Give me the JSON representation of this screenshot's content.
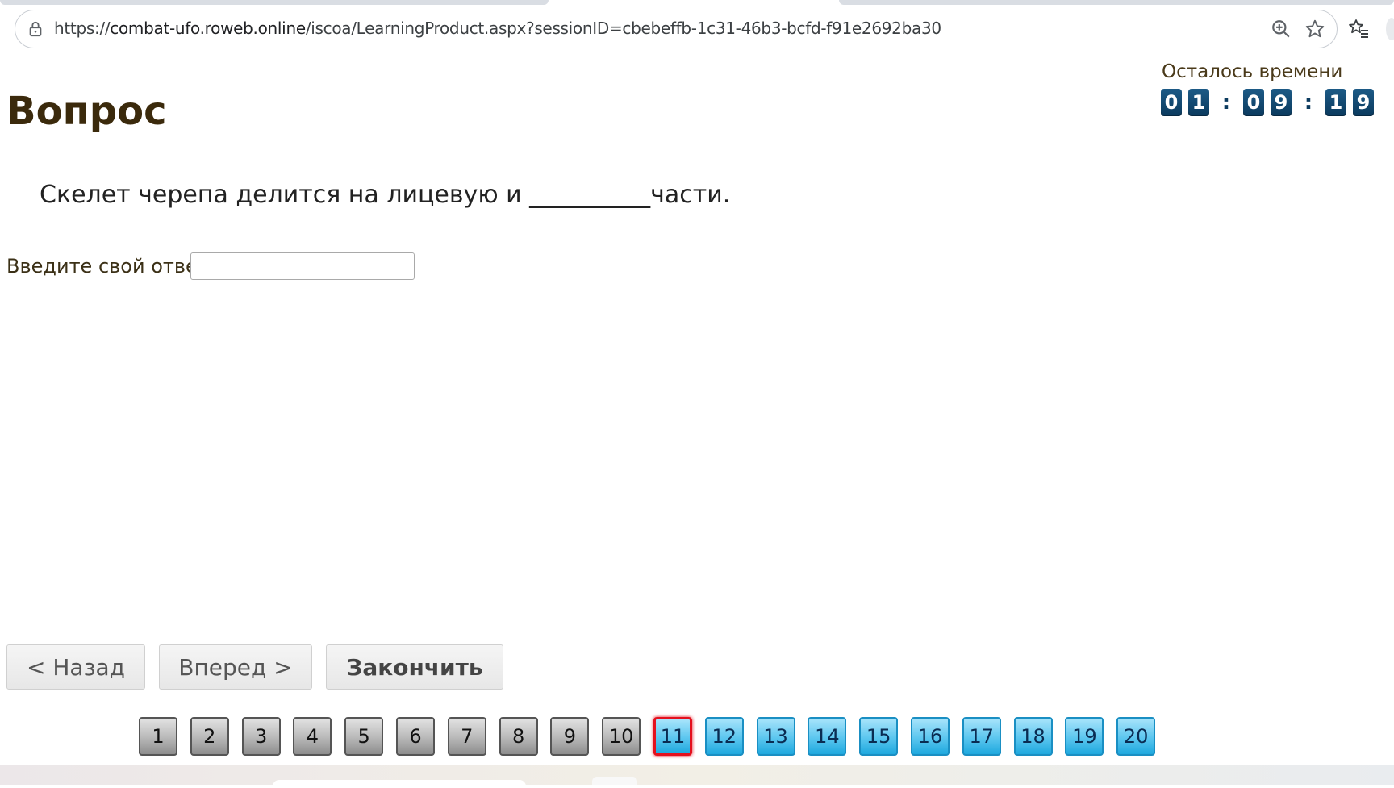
{
  "browser": {
    "url_prefix": "https://",
    "url_domain": "combat-ufo.roweb.online",
    "url_path": "/iscoa/LearningProduct.aspx?sessionID=cbebeffb-1c31-46b3-bcfd-f91e2692ba30"
  },
  "page": {
    "title": "Вопрос",
    "timer_label": "Осталось времени",
    "timer_digits": [
      "0",
      "1",
      "0",
      "9",
      "1",
      "9"
    ],
    "timer_separator": ":",
    "question": "Скелет черепа делится на лицевую и __________части.",
    "answer_label": "Введите свой ответ",
    "answer_value": ""
  },
  "nav": {
    "back_label": "< Назад",
    "next_label": "Вперед >",
    "finish_label": "Закончить"
  },
  "pager": {
    "pages": [
      "1",
      "2",
      "3",
      "4",
      "5",
      "6",
      "7",
      "8",
      "9",
      "10",
      "11",
      "12",
      "13",
      "14",
      "15",
      "16",
      "17",
      "18",
      "19",
      "20"
    ],
    "current": "11",
    "answered_count": 10
  },
  "colors": {
    "title": "#3b2a0c",
    "timer_digit_bg": "#0b3a5e",
    "pager_answered": "#8d8d8d",
    "pager_unanswered": "#1ea8de",
    "pager_current_border": "#e4101d"
  },
  "icons": {
    "address_left": "lock-icon",
    "address_right": [
      "zoom-icon",
      "star-icon"
    ],
    "toolbar": "favorites-icon"
  }
}
